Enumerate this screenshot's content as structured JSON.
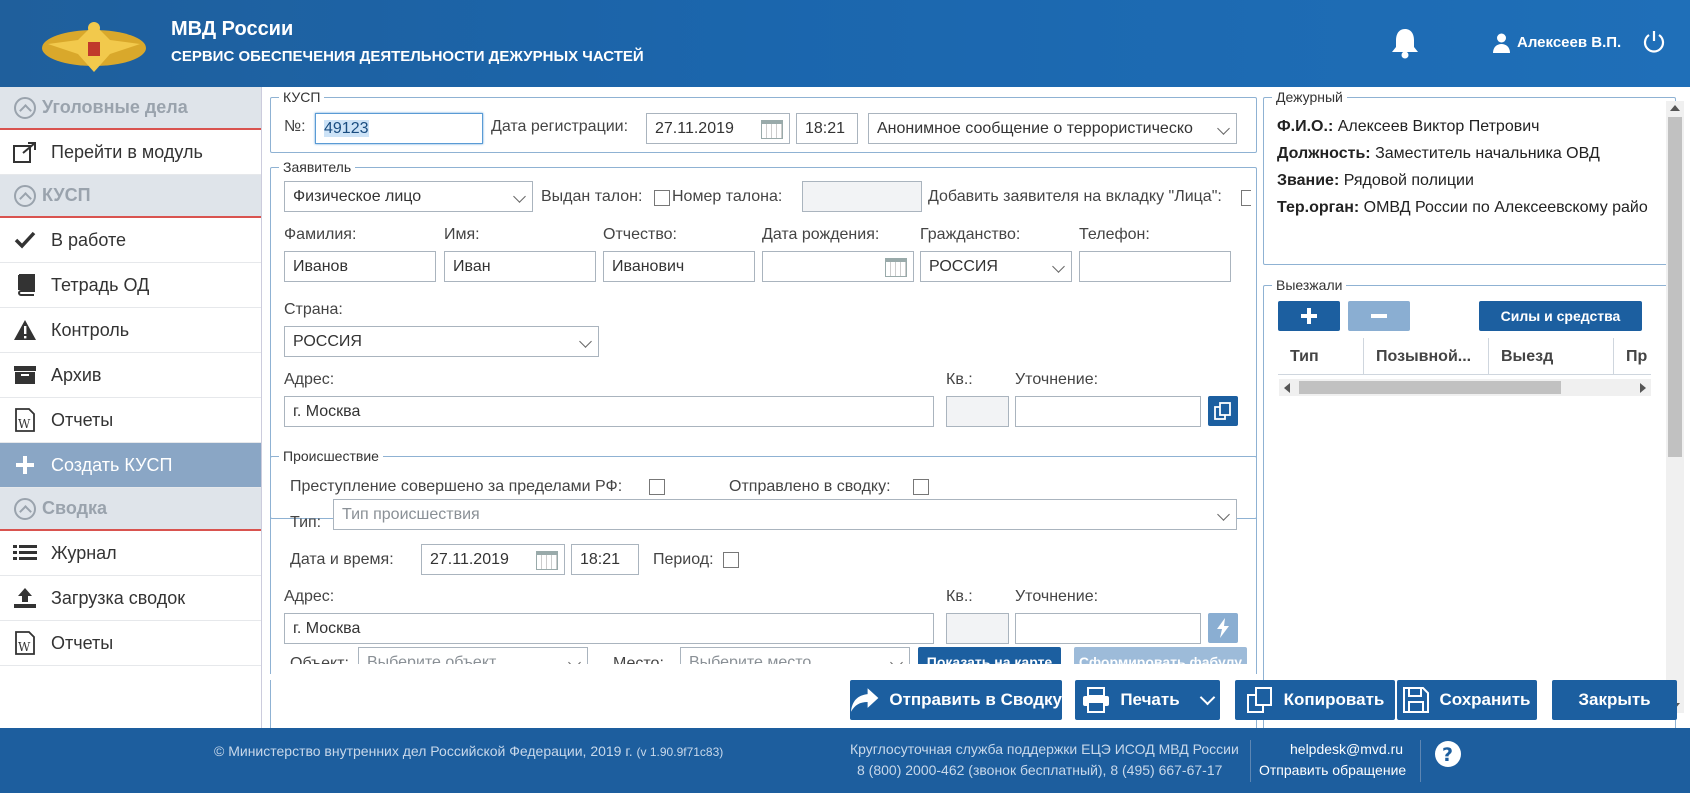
{
  "header": {
    "brand_title": "МВД России",
    "brand_subtitle": "СЕРВИС ОБЕСПЕЧЕНИЯ ДЕЯТЕЛЬНОСТИ ДЕЖУРНЫХ ЧАСТЕЙ",
    "user_name": "Алексеев В.П.",
    "icons": [
      "emblem",
      "bell-icon",
      "user-icon",
      "power-icon"
    ]
  },
  "sidebar": {
    "sections": [
      {
        "label": "Уголовные дела",
        "items": [
          {
            "label": "Перейти в модуль",
            "icon": "external-link-icon"
          }
        ]
      },
      {
        "label": "КУСП",
        "items": [
          {
            "label": "В работе",
            "icon": "check-icon"
          },
          {
            "label": "Тетрадь ОД",
            "icon": "notebook-icon"
          },
          {
            "label": "Контроль",
            "icon": "warning-icon"
          },
          {
            "label": "Архив",
            "icon": "archive-icon"
          },
          {
            "label": "Отчеты",
            "icon": "word-doc-icon"
          },
          {
            "label": "Создать КУСП",
            "icon": "plus-icon",
            "active": true
          }
        ]
      },
      {
        "label": "Сводка",
        "items": [
          {
            "label": "Журнал",
            "icon": "list-icon"
          },
          {
            "label": "Загрузка сводок",
            "icon": "upload-icon"
          },
          {
            "label": "Отчеты",
            "icon": "word-doc-icon"
          }
        ]
      }
    ],
    "collapse_label": "<<"
  },
  "kusp": {
    "legend": "КУСП",
    "number_label": "№:",
    "number_value": "49123",
    "reg_date_label": "Дата регистрации:",
    "reg_date": "27.11.2019",
    "reg_time": "18:21",
    "message_type": "Анонимное сообщение о террористическо"
  },
  "applicant": {
    "legend": "Заявитель",
    "type": "Физическое лицо",
    "ticket_issued_label": "Выдан талон:",
    "ticket_number_label": "Номер талона:",
    "ticket_number": "",
    "add_to_persons_label": "Добавить заявителя на вкладку \"Лица\":",
    "surname_label": "Фамилия:",
    "surname": "Иванов",
    "name_label": "Имя:",
    "name": "Иван",
    "patronymic_label": "Отчество:",
    "patronymic": "Иванович",
    "birth_date_label": "Дата рождения:",
    "birth_date": "",
    "citizenship_label": "Гражданство:",
    "citizenship": "РОССИЯ",
    "phone_label": "Телефон:",
    "phone": "",
    "country_label": "Страна:",
    "country": "РОССИЯ",
    "address_label": "Адрес:",
    "address": "г. Москва",
    "apt_label": "Кв.:",
    "apt": "",
    "clarify_label": "Уточнение:",
    "clarify": ""
  },
  "incident": {
    "legend": "Происшествие",
    "abroad_label": "Преступление совершено за пределами РФ:",
    "sent_label": "Отправлено в сводку:",
    "type_label": "Тип:",
    "type_placeholder": "Тип происшествия",
    "datetime_label": "Дата и время:",
    "date": "27.11.2019",
    "time": "18:21",
    "period_label": "Период:",
    "address_label": "Адрес:",
    "address": "г. Москва",
    "apt_label": "Кв.:",
    "apt": "",
    "clarify_label": "Уточнение:",
    "clarify": "",
    "object_label": "Объект:",
    "object_placeholder": "Выберите объект",
    "place_label": "Место:",
    "place_placeholder": "Выберите место",
    "show_map_label": "Показать на карте",
    "form_fabula_label": "Сформировать фабулу"
  },
  "duty": {
    "legend": "Дежурный",
    "fio_label": "Ф.И.О.:",
    "fio": "Алексеев Виктор Петрович",
    "position_label": "Должность:",
    "position": "Заместитель начальника ОВД",
    "rank_label": "Звание:",
    "rank": "Рядовой полиции",
    "org_label": "Тер.орган:",
    "org": "ОМВД России по Алексеевскому райо"
  },
  "departed": {
    "legend": "Выезжали",
    "forces_label": "Силы и средства",
    "columns": [
      "Тип",
      "Позывной...",
      "Выезд",
      "Пр"
    ]
  },
  "actions": {
    "send": "Отправить в Сводку",
    "print": "Печать",
    "copy": "Копировать",
    "save": "Сохранить",
    "close": "Закрыть"
  },
  "footer": {
    "copyright": "© Министерство внутренних дел Российской Федерации, 2019 г.",
    "version": "(v 1.90.9f71c83)",
    "support_title": "Круглосуточная служба поддержки ЕЦЭ ИСОД МВД России",
    "support_phones": "8 (800) 2000-462 (звонок бесплатный), 8 (495) 667-67-17",
    "email": "helpdesk@mvd.ru",
    "appeal": "Отправить обращение"
  },
  "colors": {
    "primary": "#1c5fa0",
    "header": "#1b66ad",
    "section_line": "#d9534f",
    "active_item": "#8aa6c5"
  }
}
